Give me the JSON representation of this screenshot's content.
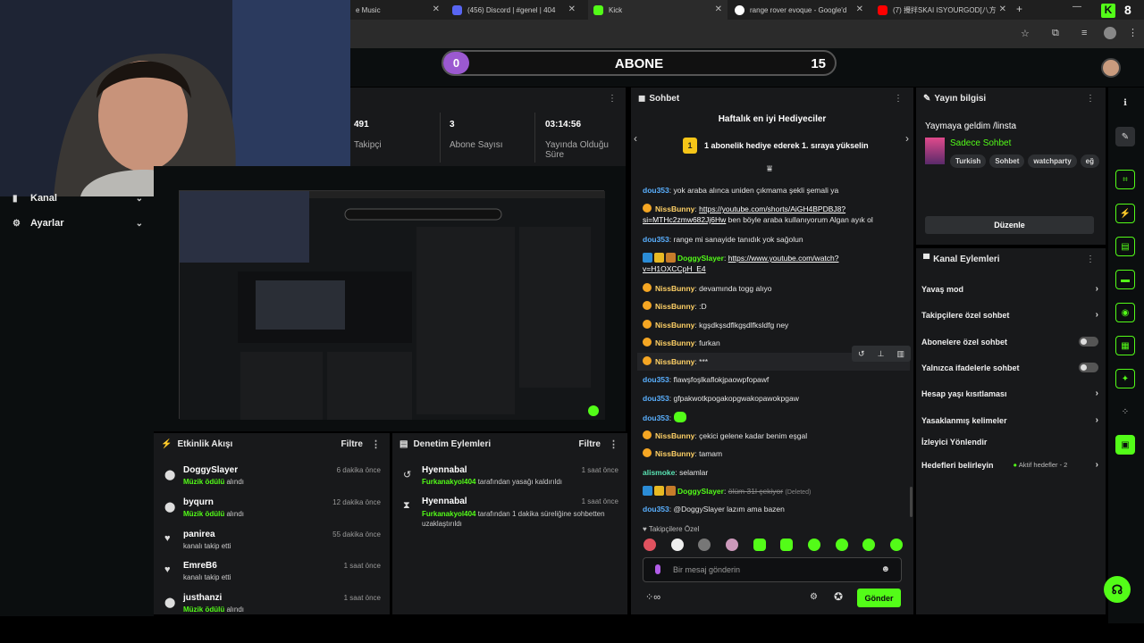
{
  "tabs": [
    {
      "label": "e Music"
    },
    {
      "label": "(456) Discord | #genel | 404"
    },
    {
      "label": "Kick"
    },
    {
      "label": "range rover evoque - Google'd"
    },
    {
      "label": "(7) 攪拌SKAI ISYOURGOD[八方"
    }
  ],
  "header": {
    "abone_count": "0",
    "abone_label": "ABONE",
    "abone_target": "15"
  },
  "nav": {
    "kanal": "Kanal",
    "ayarlar": "Ayarlar"
  },
  "stats": [
    {
      "value": "491",
      "label": "Takipçi"
    },
    {
      "value": "3",
      "label": "Abone Sayısı"
    },
    {
      "value": "03:14:56",
      "label": "Yayında Olduğu Süre"
    }
  ],
  "activity": {
    "title": "Etkinlik Akışı",
    "filter": "Filtre",
    "items": [
      {
        "name": "DoggySlayer",
        "time": "6 dakika önce",
        "hl": "Müzik ödülü",
        "rest": " alındı"
      },
      {
        "name": "byqurn",
        "time": "12 dakika önce",
        "hl": "Müzik ödülü",
        "rest": " alındı"
      },
      {
        "name": "panirea",
        "time": "55 dakika önce",
        "hl": "",
        "rest": "kanalı takip etti"
      },
      {
        "name": "EmreB6",
        "time": "1 saat önce",
        "hl": "",
        "rest": "kanalı takip etti"
      },
      {
        "name": "justhanzi",
        "time": "1 saat önce",
        "hl": "Müzik ödülü",
        "rest": " alındı"
      }
    ]
  },
  "moderation": {
    "title": "Denetim Eylemleri",
    "filter": "Filtre",
    "items": [
      {
        "name": "Hyennabal",
        "time": "1 saat önce",
        "hl": "Furkanakyol404",
        "rest": " tarafından yasağı kaldırıldı"
      },
      {
        "name": "Hyennabal",
        "time": "1 saat önce",
        "hl": "Furkanakyol404",
        "rest": " tarafından 1 dakika süreliğine sohbetten uzaklaştırıldı"
      }
    ]
  },
  "chat": {
    "title": "Sohbet",
    "gifters_title": "Haftalık en iyi Hediyeciler",
    "gifters_badge": "1",
    "gifters_text": "1 abonelik hediye ederek 1. sıraya yükselin",
    "messages": [
      {
        "user": "dou353",
        "text": "yok araba alınca uniden çıkmama şekli şemali ya"
      },
      {
        "user": "NissBunny",
        "link": "https://youtube.com/shorts/AiGH4BPDBJ8?si=MTHc2zmw682Jj6Hw",
        "text": " ben böyle araba kullanıyorum Algan ayık ol"
      },
      {
        "user": "dou353",
        "text": "range mi sanayide tanıdık yok sağolun"
      },
      {
        "user": "DoggySlayer",
        "link": "https://www.youtube.com/watch?v=H1OXCCpH_E4",
        "text": ""
      },
      {
        "user": "NissBunny",
        "text": "devamında togg alıyo"
      },
      {
        "user": "NissBunny",
        "text": ":D"
      },
      {
        "user": "NissBunny",
        "text": "kgşdkşsdflkgşdlfksldfg ney"
      },
      {
        "user": "NissBunny",
        "text": "furkan"
      },
      {
        "user": "NissBunny",
        "text": "***"
      },
      {
        "user": "dou353",
        "text": "flawşfoşlkaflokjpaowpfopawf"
      },
      {
        "user": "dou353",
        "text": "gfpakwotkpogakopgwakopawokpgaw"
      },
      {
        "user": "dou353",
        "text": ""
      },
      {
        "user": "NissBunny",
        "text": "çekici gelene kadar benim eşgal"
      },
      {
        "user": "NissBunny",
        "text": "tamam"
      },
      {
        "user": "alismoke",
        "text": "selamlar"
      },
      {
        "user": "DoggySlayer",
        "text": "ölüm 31l çekiyor",
        "deleted": "(Deleted)"
      },
      {
        "user": "dou353",
        "text": "@DoggySlayer lazım ama bazen"
      }
    ],
    "followers_only": "Takipçilere Özel",
    "placeholder": "Bir mesaj gönderin",
    "send": "Gönder"
  },
  "info": {
    "title": "Yayın bilgisi",
    "stream_title": "Yaymaya geldim /linsta",
    "category": "Sadece Sohbet",
    "tags": [
      "Turkish",
      "Sohbet",
      "watchparty",
      "eğ"
    ],
    "edit": "Düzenle"
  },
  "actions": {
    "title": "Kanal Eylemleri",
    "items": [
      {
        "label": "Yavaş mod",
        "kind": "chevron"
      },
      {
        "label": "Takipçilere özel sohbet",
        "kind": "chevron"
      },
      {
        "label": "Abonelere özel sohbet",
        "kind": "toggle"
      },
      {
        "label": "Yalnızca ifadelerle sohbet",
        "kind": "toggle"
      },
      {
        "label": "Hesap yaşı kısıtlaması",
        "kind": "chevron"
      },
      {
        "label": "Yasaklanmış kelimeler",
        "kind": "chevron"
      },
      {
        "label": "İzleyici Yönlendir",
        "kind": "none"
      },
      {
        "label": "Hedefleri belirleyin",
        "kind": "chevron",
        "extra": "Aktif hedefler - 2"
      }
    ]
  },
  "colors": {
    "accent": "#53fc18",
    "panel": "#18191b",
    "bg": "#0b0e0f"
  }
}
